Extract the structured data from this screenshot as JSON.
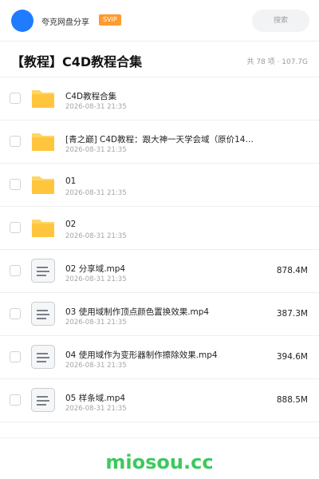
{
  "header": {
    "username": "夸克网盘分享",
    "badge": "SVIP",
    "search_placeholder": "搜索"
  },
  "folder": {
    "title": "【教程】C4D教程合集",
    "meta": "共 78 项 · 107.7G"
  },
  "items": [
    {
      "type": "folder",
      "name": "C4D教程合集",
      "date": "2026-08-31 21:35",
      "size": ""
    },
    {
      "type": "folder",
      "name": "[青之巅] C4D教程：跟大神一天学会域（原价14…",
      "date": "2026-08-31 21:35",
      "size": ""
    },
    {
      "type": "folder",
      "name": "01",
      "date": "2026-08-31 21:35",
      "size": ""
    },
    {
      "type": "folder",
      "name": "02",
      "date": "2026-08-31 21:35",
      "size": ""
    },
    {
      "type": "file",
      "name": "02 分享域.mp4",
      "date": "2026-08-31 21:35",
      "size": "878.4M"
    },
    {
      "type": "file",
      "name": "03 使用域制作顶点颜色置换效果.mp4",
      "date": "2026-08-31 21:35",
      "size": "387.3M"
    },
    {
      "type": "file",
      "name": "04 使用域作为变形器制作擦除效果.mp4",
      "date": "2026-08-31 21:35",
      "size": "394.6M"
    },
    {
      "type": "file",
      "name": "05 样条域.mp4",
      "date": "2026-08-31 21:35",
      "size": "888.5M"
    }
  ],
  "footer": {
    "brand": "miosou.cc"
  },
  "colors": {
    "avatar": "#1f7cff",
    "svip": "#ff9a2e",
    "folder": "#ffc53d",
    "brand": "#3ec85e"
  }
}
